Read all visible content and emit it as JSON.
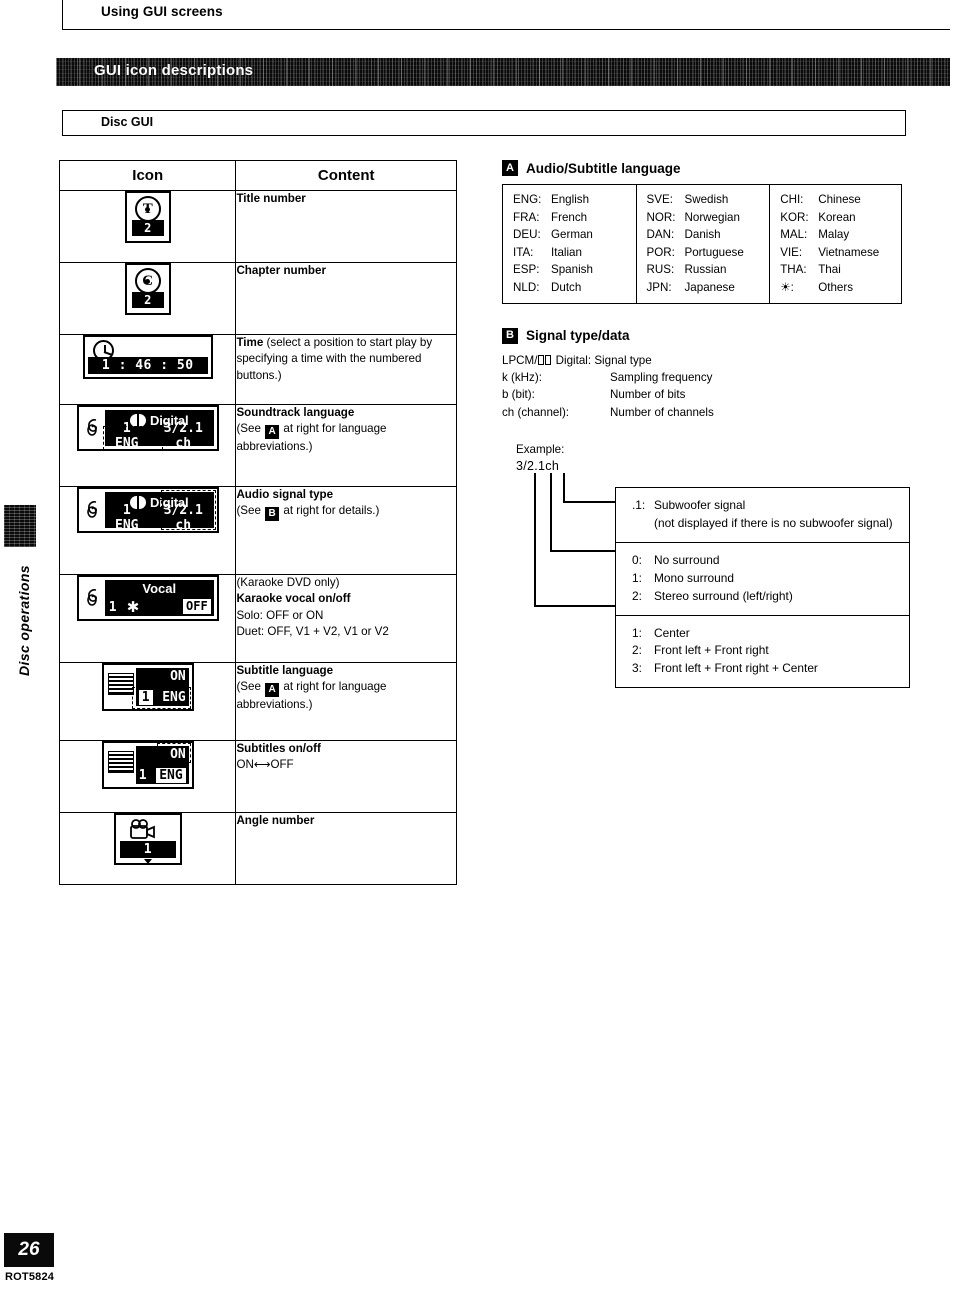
{
  "running_head": "Using GUI screens",
  "section_banner": "GUI icon descriptions",
  "subsection_bar": "Disc GUI",
  "side_tab": "Disc operations",
  "footer": {
    "page_number": "26",
    "doc_code": "ROT5824"
  },
  "icon_table": {
    "headers": {
      "icon": "Icon",
      "content": "Content"
    },
    "rows": [
      {
        "icon_name": "title-number-icon",
        "icon_value": "2",
        "icon_letter": "T",
        "title": "Title number",
        "lines": []
      },
      {
        "icon_name": "chapter-number-icon",
        "icon_value": "2",
        "icon_letter": "C",
        "title": "Chapter number",
        "lines": []
      },
      {
        "icon_name": "time-icon",
        "icon_value": "1 : 46 : 50",
        "title": "Time",
        "lines": [
          "(select a position to start play by specifying a time with the numbered buttons.)"
        ]
      },
      {
        "icon_name": "soundtrack-language-icon",
        "icon_digital": "Digital",
        "icon_lang": "1 ENG",
        "icon_ch": "3/2.1 ch",
        "title": "Soundtrack language",
        "lines_pre": "(See ",
        "lines_ref": "A",
        "lines_post": " at right for language abbreviations.)"
      },
      {
        "icon_name": "audio-signal-type-icon",
        "icon_digital": "Digital",
        "icon_lang": "1 ENG",
        "icon_ch": "3/2.1 ch",
        "title": "Audio signal type",
        "lines_pre": "(See ",
        "lines_ref": "B",
        "lines_post": " at right for details.)"
      },
      {
        "icon_name": "karaoke-vocal-icon",
        "icon_vocal": "Vocal",
        "icon_num": "1",
        "icon_star": "✱",
        "icon_off": "OFF",
        "pre_title": "(Karaoke DVD only)",
        "title": "Karaoke vocal on/off",
        "line1": "Solo:  OFF or ON",
        "line2": "Duet:  OFF, V1 + V2, V1 or V2"
      },
      {
        "icon_name": "subtitle-language-icon",
        "icon_on": "ON",
        "icon_num": "1",
        "icon_lang": "ENG",
        "title": "Subtitle language",
        "lines_pre": "(See ",
        "lines_ref": "A",
        "lines_post": " at right for language abbreviations.)"
      },
      {
        "icon_name": "subtitles-on-off-icon",
        "icon_on": "ON",
        "icon_num": "1",
        "icon_lang": "ENG",
        "title": "Subtitles on/off",
        "line1": "ON⟷OFF"
      },
      {
        "icon_name": "angle-number-icon",
        "icon_value": "1",
        "title": "Angle number",
        "lines": []
      }
    ]
  },
  "language_section": {
    "badge": "A",
    "title": "Audio/Subtitle language",
    "columns": [
      [
        {
          "code": "ENG:",
          "name": "English"
        },
        {
          "code": "FRA:",
          "name": "French"
        },
        {
          "code": "DEU:",
          "name": "German"
        },
        {
          "code": "ITA:",
          "name": "Italian"
        },
        {
          "code": "ESP:",
          "name": "Spanish"
        },
        {
          "code": "NLD:",
          "name": "Dutch"
        }
      ],
      [
        {
          "code": "SVE:",
          "name": "Swedish"
        },
        {
          "code": "NOR:",
          "name": "Norwegian"
        },
        {
          "code": "DAN:",
          "name": "Danish"
        },
        {
          "code": "POR:",
          "name": "Portuguese"
        },
        {
          "code": "RUS:",
          "name": "Russian"
        },
        {
          "code": "JPN:",
          "name": "Japanese"
        }
      ],
      [
        {
          "code": "CHI:",
          "name": "Chinese"
        },
        {
          "code": "KOR:",
          "name": "Korean"
        },
        {
          "code": "MAL:",
          "name": "Malay"
        },
        {
          "code": "VIE:",
          "name": "Vietnamese"
        },
        {
          "code": "THA:",
          "name": "Thai"
        },
        {
          "code": "☀:",
          "name": "Others"
        }
      ]
    ]
  },
  "signal_section": {
    "badge": "B",
    "title": "Signal type/data",
    "first_line_pre": "LPCM/",
    "first_line_post": " Digital:  Signal type",
    "rows": [
      {
        "key": "k (kHz):",
        "value": "Sampling frequency"
      },
      {
        "key": "b (bit):",
        "value": "Number of bits"
      },
      {
        "key": "ch (channel):",
        "value": "Number of channels"
      }
    ],
    "example_label": "Example:",
    "example_value": "3/2.1ch",
    "boxes": [
      {
        "name": "subwoofer-box",
        "lines": [
          {
            "n": ".1:",
            "t": "Subwoofer signal"
          }
        ],
        "sub": "(not displayed if there is no subwoofer signal)"
      },
      {
        "name": "surround-box",
        "lines": [
          {
            "n": "0:",
            "t": "No surround"
          },
          {
            "n": "1:",
            "t": "Mono surround"
          },
          {
            "n": "2:",
            "t": "Stereo surround (left/right)"
          }
        ],
        "sub": ""
      },
      {
        "name": "front-box",
        "lines": [
          {
            "n": "1:",
            "t": "Center"
          },
          {
            "n": "2:",
            "t": "Front left + Front right"
          },
          {
            "n": "3:",
            "t": "Front left + Front right + Center"
          }
        ],
        "sub": ""
      }
    ]
  }
}
